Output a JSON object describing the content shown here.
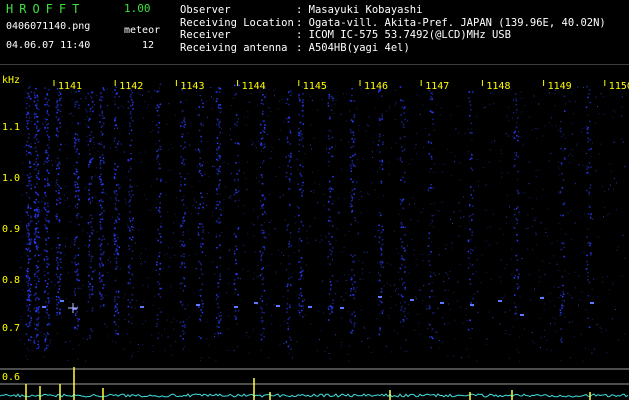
{
  "header": {
    "app_name": "HROFFT",
    "app_version": "1.00",
    "file_name": "0406071140.png",
    "timestamp": "04.06.07 11:40",
    "meteor_label": "meteor",
    "meteor_count": "12"
  },
  "station_info": [
    {
      "label": "Observer",
      "value": ": Masayuki Kobayashi"
    },
    {
      "label": "Receiving Location",
      "value": ": Ogata-vill. Akita-Pref. JAPAN (139.96E, 40.02N)"
    },
    {
      "label": "Receiver",
      "value": ": ICOM IC-575 53.7492(@LCD)MHz USB"
    },
    {
      "label": "Receiving antenna",
      "value": ": A504HB(yagi 4el)"
    }
  ],
  "spectrogram": {
    "frequency_unit": "kHz",
    "y_ticks": [
      "1.1",
      "1.0",
      "0.9",
      "0.8",
      "0.7",
      "0.6"
    ],
    "time_ticks": [
      "1141",
      "1142",
      "1143",
      "1144",
      "1145",
      "1146",
      "1147",
      "1148",
      "1149",
      "1150"
    ],
    "colors": {
      "background": "#000000",
      "signal": "#2a3cff",
      "label": "#ffff00",
      "trace": "#3fe0e0",
      "peak": "#ffff40"
    }
  }
}
